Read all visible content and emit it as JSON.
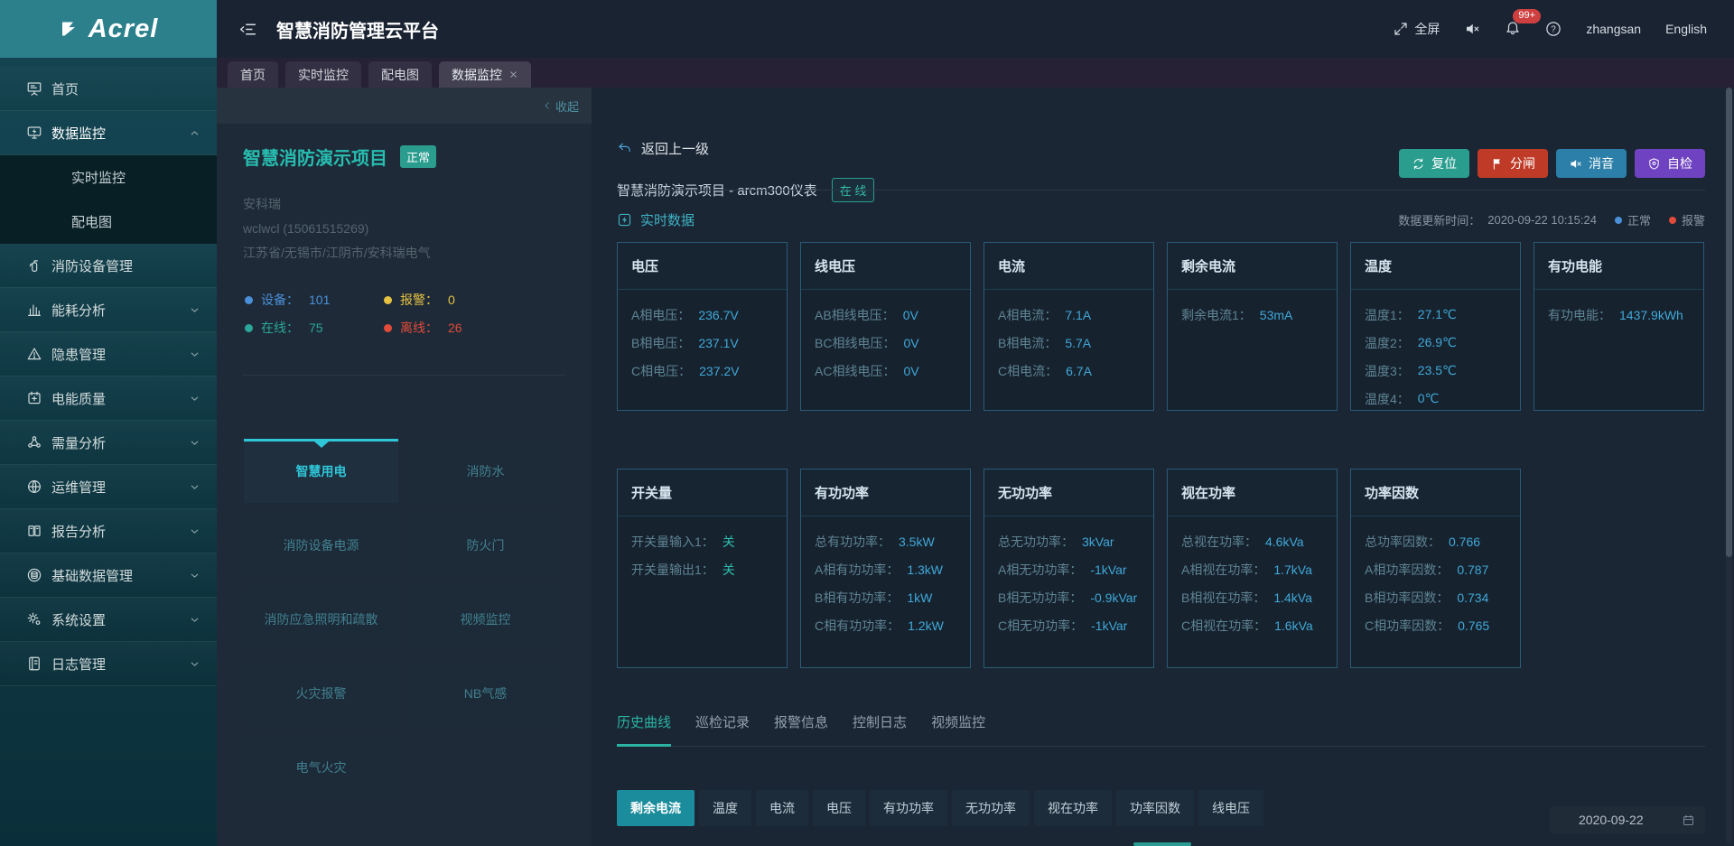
{
  "brand": {
    "name": "Acrel"
  },
  "header": {
    "title": "智慧消防管理云平台",
    "fullscreen_label": "全屏",
    "notification_badge": "99+",
    "username": "zhangsan",
    "language": "English"
  },
  "tabs": [
    {
      "label": "首页"
    },
    {
      "label": "实时监控"
    },
    {
      "label": "配电图"
    },
    {
      "label": "数据监控",
      "active": true,
      "closable": true
    }
  ],
  "sidebar": {
    "items": [
      {
        "icon": "home",
        "label": "首页"
      },
      {
        "icon": "monitor",
        "label": "数据监控",
        "chevron": "chevron-up",
        "cls": "active"
      },
      {
        "label": "实时监控",
        "cls": "sub"
      },
      {
        "label": "配电图",
        "cls": "sub"
      },
      {
        "icon": "extinguisher",
        "label": "消防设备管理"
      },
      {
        "icon": "bars",
        "label": "能耗分析",
        "chevron": "chevron-down"
      },
      {
        "icon": "warning",
        "label": "隐患管理",
        "chevron": "chevron-down"
      },
      {
        "icon": "quality",
        "label": "电能质量",
        "chevron": "chevron-down"
      },
      {
        "icon": "nodes",
        "label": "需量分析",
        "chevron": "chevron-down"
      },
      {
        "icon": "globe",
        "label": "运维管理",
        "chevron": "chevron-down"
      },
      {
        "icon": "report",
        "label": "报告分析",
        "chevron": "chevron-down"
      },
      {
        "icon": "database",
        "label": "基础数据管理",
        "chevron": "chevron-down"
      },
      {
        "icon": "gears",
        "label": "系统设置",
        "chevron": "chevron-down"
      },
      {
        "icon": "log",
        "label": "日志管理",
        "chevron": "chevron-down"
      }
    ]
  },
  "panel": {
    "collapse_label": "收起",
    "project_name": "智慧消防演示项目",
    "status_badge": "正常",
    "company": "安科瑞",
    "contact": "wclwcl (15061515269)",
    "address": "江苏省/无锡市/江阴市/安科瑞电气",
    "stats": [
      {
        "label": "设备：",
        "value": "101",
        "color": "#4a90d9"
      },
      {
        "label": "报警：",
        "value": "0",
        "color": "#e6c243"
      },
      {
        "label": "在线：",
        "value": "75",
        "color": "#2aa79a"
      },
      {
        "label": "离线：",
        "value": "26",
        "color": "#e04b3a"
      }
    ],
    "tiles": [
      {
        "label": "智慧用电",
        "active": true
      },
      {
        "label": "消防水"
      },
      {
        "label": "消防设备电源"
      },
      {
        "label": "防火门"
      },
      {
        "label": "消防应急照明和疏散"
      },
      {
        "label": "视频监控"
      },
      {
        "label": "火灾报警"
      },
      {
        "label": "NB气感"
      },
      {
        "label": "电气火灾"
      }
    ]
  },
  "main": {
    "back_label": "返回上一级",
    "device_title": "智慧消防演示项目 - arcm300仪表",
    "online_badge": "在 线",
    "actions": [
      {
        "label": "复位",
        "icon": "reset",
        "color": "#2a9d8f"
      },
      {
        "label": "分闸",
        "icon": "flag",
        "color": "#bf3b27"
      },
      {
        "label": "消音",
        "icon": "mute",
        "color": "#2b7fa8"
      },
      {
        "label": "自检",
        "icon": "shield",
        "color": "#6f42c1"
      }
    ],
    "section_title": "实时数据",
    "update_label": "数据更新时间：",
    "update_time": "2020-09-22 10:15:24",
    "legend": [
      {
        "label": "正常",
        "color": "#4a90d9"
      },
      {
        "label": "报警",
        "color": "#e04b3a"
      }
    ],
    "cards_row1": [
      {
        "title": "电压",
        "rows": [
          {
            "label": "A相电压：",
            "value": "236.7V"
          },
          {
            "label": "B相电压：",
            "value": "237.1V"
          },
          {
            "label": "C相电压：",
            "value": "237.2V"
          }
        ]
      },
      {
        "title": "线电压",
        "rows": [
          {
            "label": "AB相线电压：",
            "value": "0V"
          },
          {
            "label": "BC相线电压：",
            "value": "0V"
          },
          {
            "label": "AC相线电压：",
            "value": "0V"
          }
        ]
      },
      {
        "title": "电流",
        "rows": [
          {
            "label": "A相电流：",
            "value": "7.1A"
          },
          {
            "label": "B相电流：",
            "value": "5.7A"
          },
          {
            "label": "C相电流：",
            "value": "6.7A"
          }
        ]
      },
      {
        "title": "剩余电流",
        "rows": [
          {
            "label": "剩余电流1：",
            "value": "53mA"
          }
        ]
      },
      {
        "title": "温度",
        "rows": [
          {
            "label": "温度1：",
            "value": "27.1℃"
          },
          {
            "label": "温度2：",
            "value": "26.9℃"
          },
          {
            "label": "温度3：",
            "value": "23.5℃"
          },
          {
            "label": "温度4：",
            "value": "0℃"
          }
        ]
      },
      {
        "title": "有功电能",
        "rows": [
          {
            "label": "有功电能：",
            "value": "1437.9kWh"
          }
        ]
      }
    ],
    "cards_row2": [
      {
        "title": "开关量",
        "rows": [
          {
            "label": "开关量输入1：",
            "value": "关",
            "vc": "#2fbfae"
          },
          {
            "label": "开关量输出1：",
            "value": "关",
            "vc": "#2fbfae"
          }
        ]
      },
      {
        "title": "有功功率",
        "rows": [
          {
            "label": "总有功功率：",
            "value": "3.5kW"
          },
          {
            "label": "A相有功功率：",
            "value": "1.3kW"
          },
          {
            "label": "B相有功功率：",
            "value": "1kW"
          },
          {
            "label": "C相有功功率：",
            "value": "1.2kW"
          }
        ]
      },
      {
        "title": "无功功率",
        "rows": [
          {
            "label": "总无功功率：",
            "value": "3kVar"
          },
          {
            "label": "A相无功功率：",
            "value": "-1kVar"
          },
          {
            "label": "B相无功功率：",
            "value": "-0.9kVar"
          },
          {
            "label": "C相无功功率：",
            "value": "-1kVar"
          }
        ]
      },
      {
        "title": "视在功率",
        "rows": [
          {
            "label": "总视在功率：",
            "value": "4.6kVa"
          },
          {
            "label": "A相视在功率：",
            "value": "1.7kVa"
          },
          {
            "label": "B相视在功率：",
            "value": "1.4kVa"
          },
          {
            "label": "C相视在功率：",
            "value": "1.6kVa"
          }
        ]
      },
      {
        "title": "功率因数",
        "rows": [
          {
            "label": "总功率因数：",
            "value": "0.766"
          },
          {
            "label": "A相功率因数：",
            "value": "0.787"
          },
          {
            "label": "B相功率因数：",
            "value": "0.734"
          },
          {
            "label": "C相功率因数：",
            "value": "0.765"
          }
        ]
      }
    ],
    "bottom_tabs": [
      {
        "label": "历史曲线",
        "active": true
      },
      {
        "label": "巡检记录"
      },
      {
        "label": "报警信息"
      },
      {
        "label": "控制日志"
      },
      {
        "label": "视频监控"
      }
    ],
    "chips": [
      {
        "label": "剩余电流",
        "active": true
      },
      {
        "label": "温度"
      },
      {
        "label": "电流"
      },
      {
        "label": "电压"
      },
      {
        "label": "有功功率"
      },
      {
        "label": "无功功率"
      },
      {
        "label": "视在功率"
      },
      {
        "label": "功率因数"
      },
      {
        "label": "线电压"
      }
    ],
    "date_value": "2020-09-22"
  }
}
